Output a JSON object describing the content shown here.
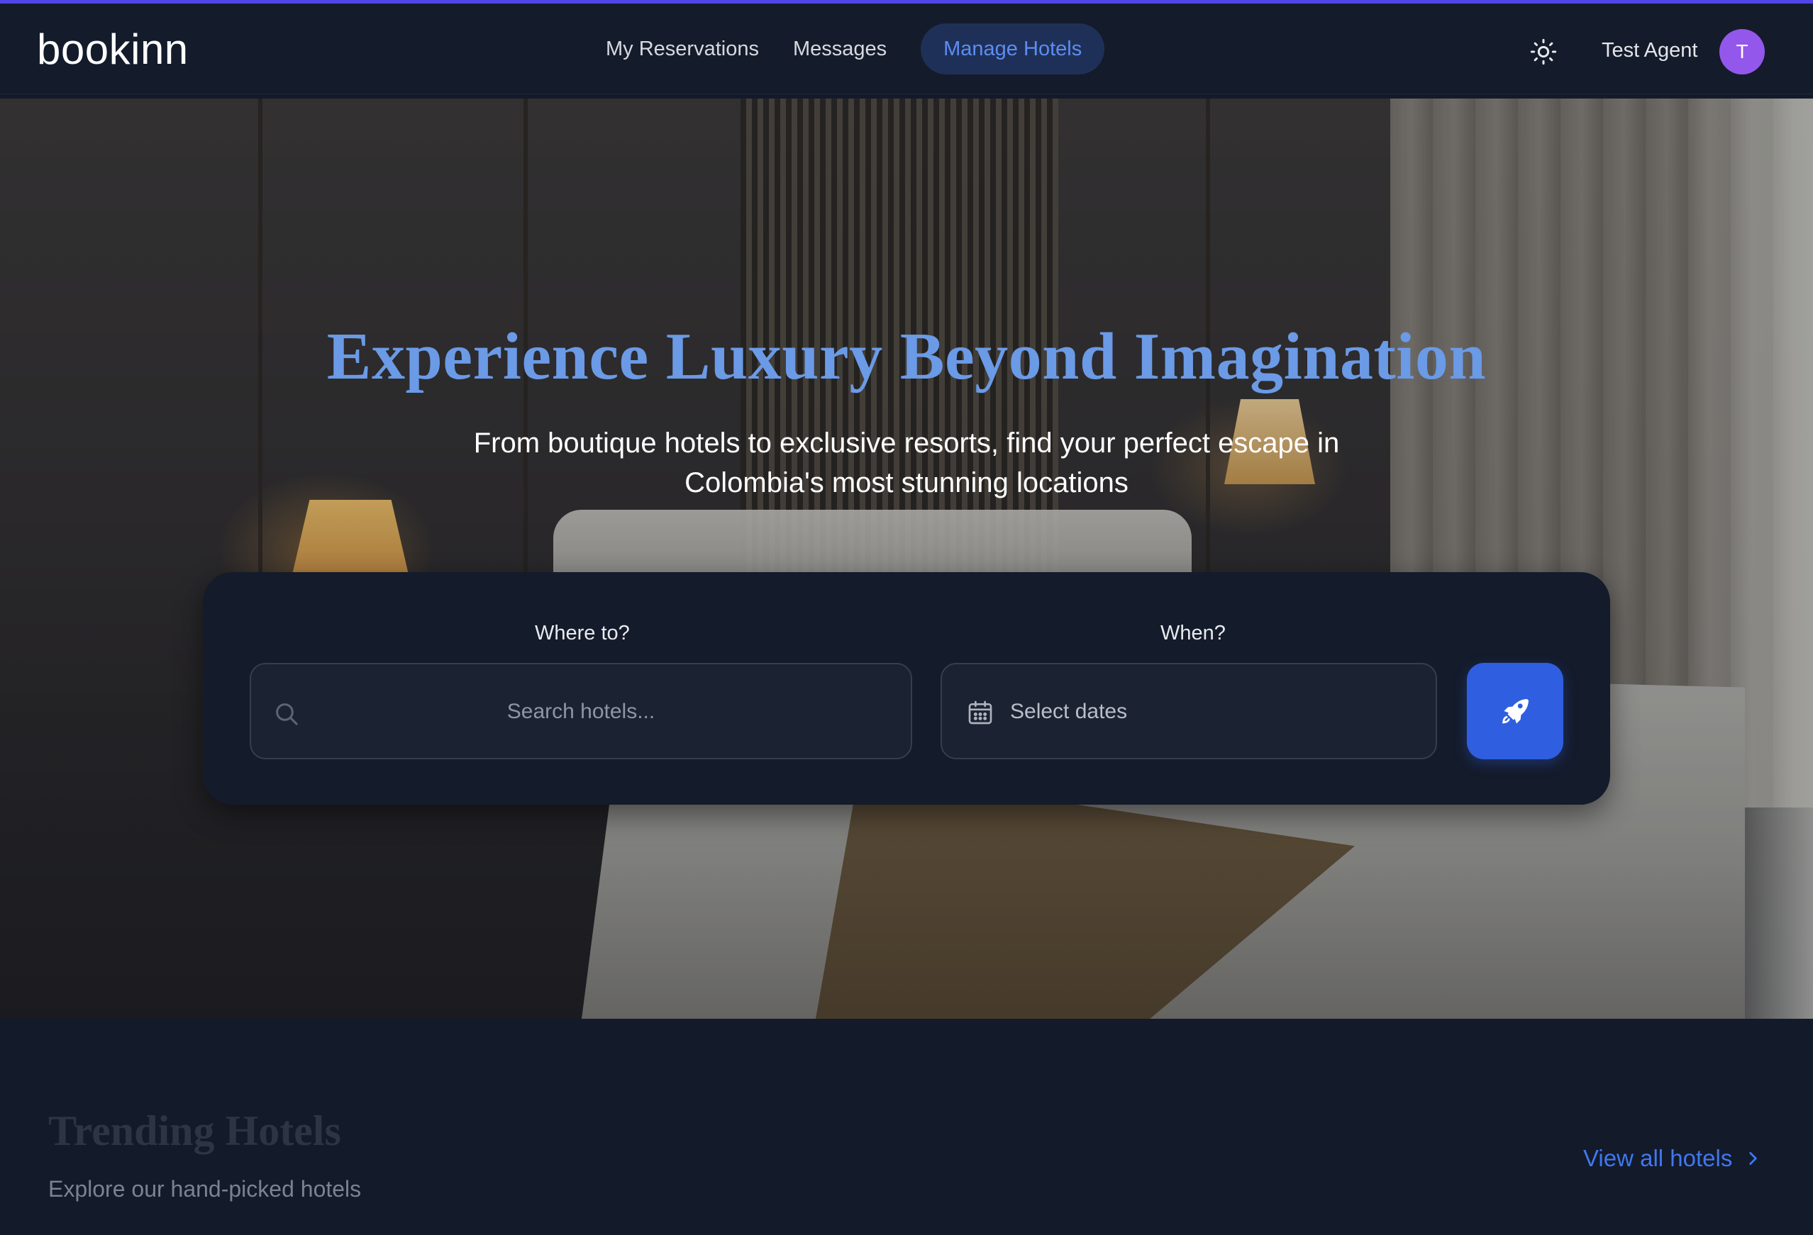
{
  "brand": {
    "logo_text": "bookinn"
  },
  "nav": {
    "links": [
      {
        "label": "My Reservations",
        "active": false
      },
      {
        "label": "Messages",
        "active": false
      },
      {
        "label": "Manage Hotels",
        "active": true
      }
    ],
    "theme_icon": "sun-icon",
    "user_name": "Test Agent",
    "avatar_initial": "T"
  },
  "hero": {
    "title": "Experience Luxury Beyond Imagination",
    "subtitle": "From boutique hotels to exclusive resorts, find your perfect escape in Colombia's most stunning locations"
  },
  "search": {
    "where_label": "Where to?",
    "search_placeholder": "Search hotels...",
    "when_label": "When?",
    "dates_placeholder": "Select dates",
    "search_button_icon": "rocket-icon"
  },
  "trending": {
    "title": "Trending Hotels",
    "subtitle": "Explore our hand-picked hotels",
    "view_all_label": "View all hotels"
  },
  "colors": {
    "background": "#131a2a",
    "accent": "#2f5fe0",
    "title_blue": "#6b9ae6",
    "link_blue": "#3f78f0",
    "avatar": "#9457eb",
    "top_border": "#4f46e5"
  }
}
